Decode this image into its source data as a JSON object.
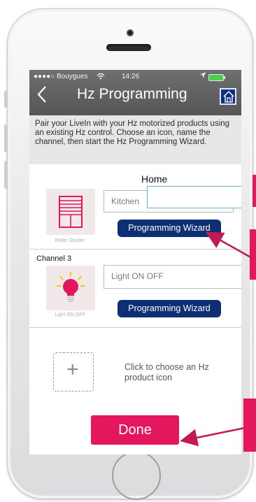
{
  "status_bar": {
    "carrier": "●●●●○ Bouygues",
    "wifi_icon": "wifi-icon",
    "time": "14:26",
    "location_icon": "location-arrow-icon",
    "battery_icon": "battery-icon"
  },
  "header": {
    "title": "Hz Programming",
    "back_icon": "chevron-left-icon",
    "home_icon": "home-icon"
  },
  "intro": {
    "text": "Pair your LiveIn with your Hz motorized products using an existing Hz control. Choose an icon, name the channel, then start the Hz Programming Wizard."
  },
  "section": {
    "home_label": "Home"
  },
  "channels": [
    {
      "product_icon": "roller-shutter-icon",
      "product_caption": "Roller Shutter",
      "name_value": "Kitchen",
      "wizard_label": "Programming Wizard"
    },
    {
      "channel_label": "Channel 3",
      "product_icon": "light-bulb-icon",
      "product_caption": "Light ON OFF",
      "name_value": "Light ON OFF",
      "wizard_label": "Programming Wizard"
    }
  ],
  "add_product": {
    "icon": "plus-icon",
    "text": "Click to choose an Hz product icon"
  },
  "footer": {
    "done_label": "Done"
  },
  "colors": {
    "accent_pink": "#e3165e",
    "navy_button": "#0d2f73",
    "header_gray": "#606062",
    "bulb_pink": "#e3165e",
    "bulb_yellow": "#f6c800"
  }
}
